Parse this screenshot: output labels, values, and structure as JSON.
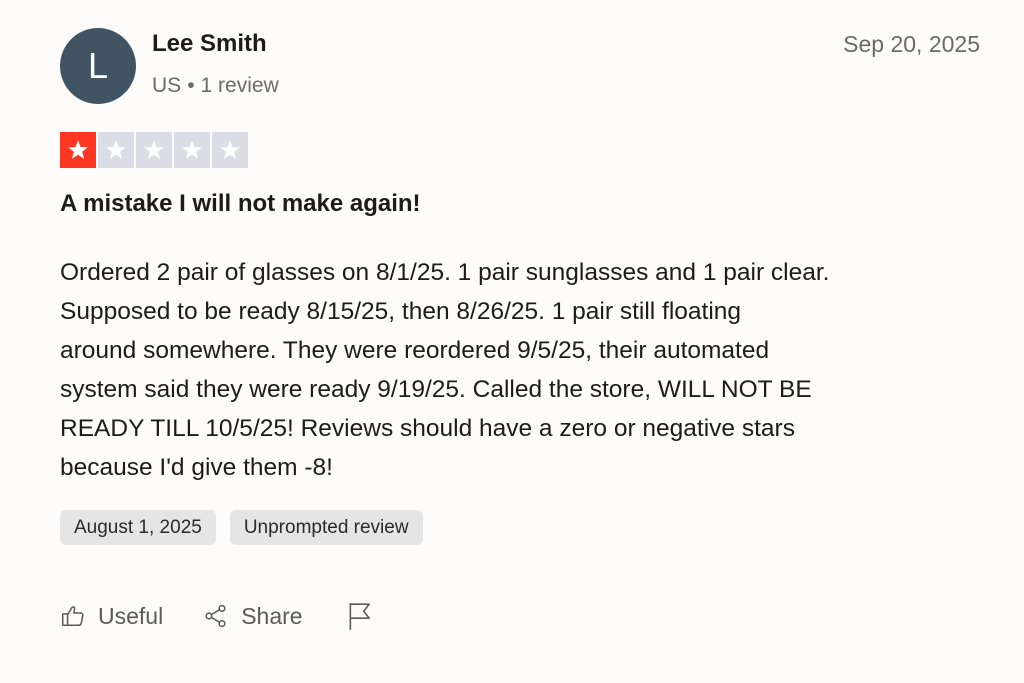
{
  "reviewer": {
    "initial": "L",
    "name": "Lee Smith",
    "country": "US",
    "separator": "•",
    "review_count": "1 review"
  },
  "review": {
    "date": "Sep 20, 2025",
    "rating": 1,
    "rating_max": 5,
    "title": "A mistake I will not make again!",
    "body_lines": [
      "Ordered 2 pair of glasses on 8/1/25. 1 pair sunglasses and 1 pair clear.",
      "Supposed to be ready 8/15/25, then 8/26/25. 1 pair still floating",
      "around somewhere. They were reordered 9/5/25, their automated",
      "system said they were ready 9/19/25. Called the store, WILL NOT BE",
      "READY TILL 10/5/25! Reviews should have a zero or negative stars",
      "because I'd give them -8!"
    ],
    "experience_date": "August 1, 2025",
    "review_type": "Unprompted review"
  },
  "actions": {
    "useful_label": "Useful",
    "share_label": "Share",
    "useful_icon": "thumbs-up-icon",
    "share_icon": "share-icon",
    "report_icon": "flag-icon"
  },
  "colors": {
    "avatar_bg": "#405463",
    "star_filled": "#ff3722",
    "star_empty": "#dcdce6",
    "tag_bg": "#e5e5e5"
  }
}
